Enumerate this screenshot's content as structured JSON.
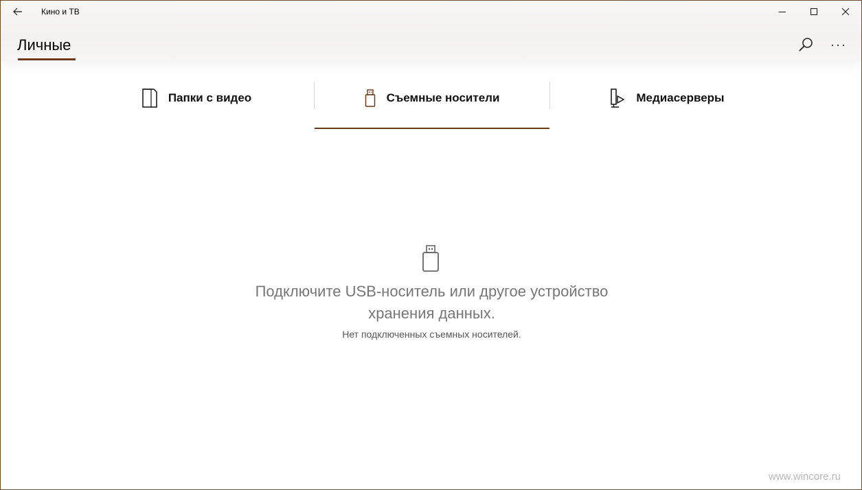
{
  "window": {
    "title": "Кино и ТВ",
    "back_icon": "back-arrow-icon",
    "minimize_icon": "minimize-icon",
    "maximize_icon": "maximize-icon",
    "close_icon": "close-icon"
  },
  "header": {
    "page_title": "Личные",
    "search_icon": "search-icon",
    "more_label": "···"
  },
  "tabs": [
    {
      "label": "Папки с видео",
      "icon": "folder-icon",
      "selected": false
    },
    {
      "label": "Съемные носители",
      "icon": "usb-drive-icon",
      "selected": true
    },
    {
      "label": "Медиасерверы",
      "icon": "media-server-icon",
      "selected": false
    }
  ],
  "empty_state": {
    "icon": "usb-drive-icon",
    "message": "Подключите USB-носитель или другое устройство хранения данных.",
    "subtext": "Нет подключенных съемных носителей."
  },
  "watermark": "www.wincore.ru",
  "colors": {
    "accent": "#6b3a1a",
    "border": "#6b4a2e",
    "muted_text": "#767676"
  }
}
